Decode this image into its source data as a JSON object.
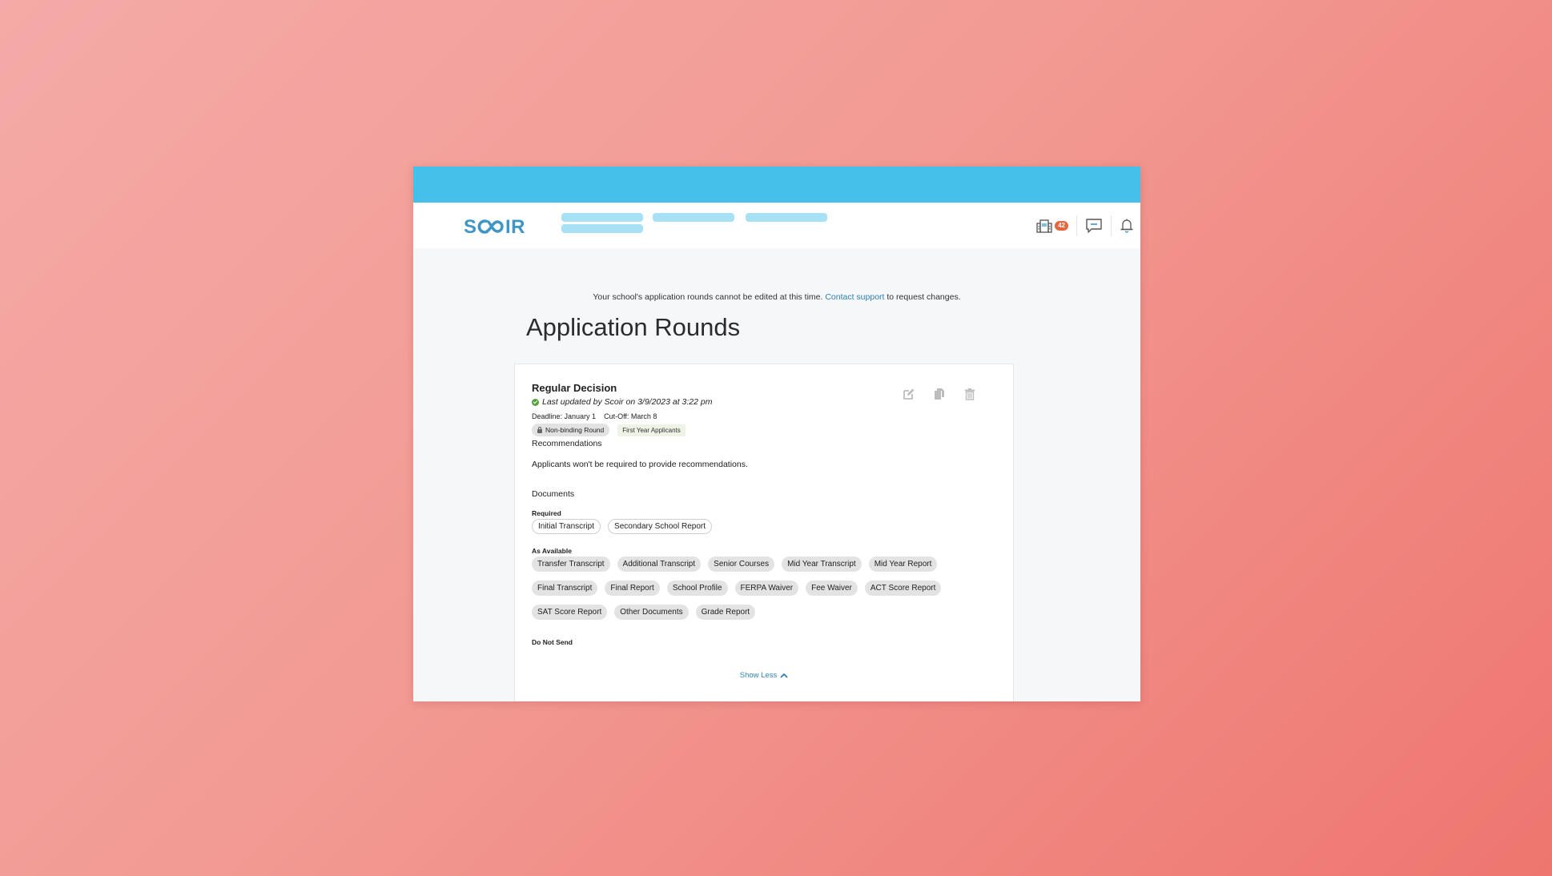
{
  "brand": {
    "logo_text": "SCOIR",
    "accent": "#45c0ea",
    "logo_color": "#3f95c6"
  },
  "nav": {
    "badge_count": "42",
    "icons": [
      "college-building-icon",
      "message-icon",
      "bell-icon"
    ]
  },
  "notice": {
    "before": "Your school's application rounds cannot be edited at this time. ",
    "link": "Contact support",
    "after": " to request changes."
  },
  "page_title": "Application Rounds",
  "round": {
    "name": "Regular Decision",
    "last_updated": "Last updated by Scoir on 3/9/2023 at 3:22 pm",
    "deadline": "Deadline: January 1",
    "cutoff": "Cut-Off: March 8",
    "tags": {
      "binding": "Non-binding Round",
      "applicant_type": "First Year Applicants"
    },
    "actions": [
      "edit",
      "copy",
      "delete"
    ],
    "recommendations": {
      "heading": "Recommendations",
      "text": "Applicants won't be required to provide recommendations."
    },
    "documents": {
      "heading": "Documents",
      "required_label": "Required",
      "required": [
        "Initial Transcript",
        "Secondary School Report"
      ],
      "as_available_label": "As Available",
      "as_available": [
        "Transfer Transcript",
        "Additional Transcript",
        "Senior Courses",
        "Mid Year Transcript",
        "Mid Year Report",
        "Final Transcript",
        "Final Report",
        "School Profile",
        "FERPA Waiver",
        "Fee Waiver",
        "ACT Score Report",
        "SAT Score Report",
        "Other Documents",
        "Grade Report"
      ],
      "do_not_send_label": "Do Not Send"
    },
    "show_less_label": "Show Less"
  }
}
